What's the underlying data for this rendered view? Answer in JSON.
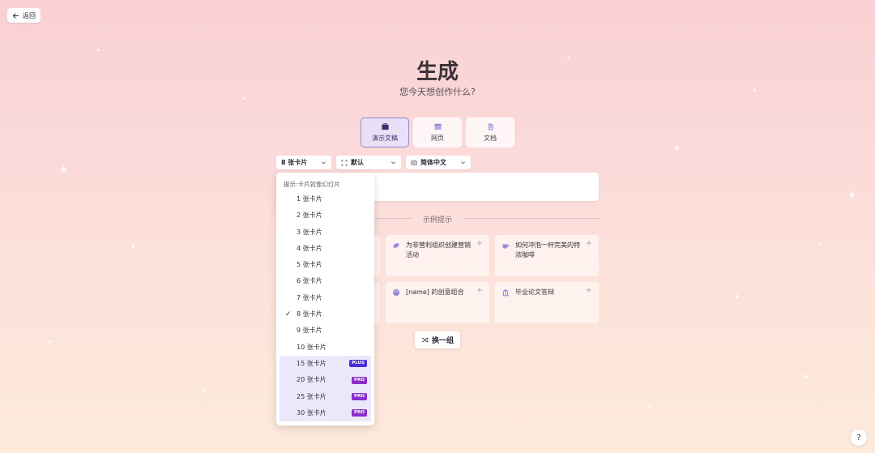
{
  "header": {
    "back_label": "返回"
  },
  "hero": {
    "title": "生成",
    "subtitle": "您今天想创作什么?"
  },
  "types": [
    {
      "label": "演示文稿",
      "icon": "presentation-icon",
      "active": true
    },
    {
      "label": "网页",
      "icon": "webpage-icon",
      "active": false
    },
    {
      "label": "文档",
      "icon": "document-icon",
      "active": false
    }
  ],
  "selects": {
    "cards": "8 张卡片",
    "layout": "默认",
    "language": "简体中文"
  },
  "examples": {
    "label": "示例提示",
    "cards": [
      {
        "text": "为非营利组织创建营销活动",
        "icon": "megaphone-icon"
      },
      {
        "text": "如何冲泡一杯完美的特浓咖啡",
        "icon": "coffee-icon"
      },
      {
        "text": "[name] 的创意组合",
        "icon": "palette-icon"
      },
      {
        "text": "毕业论文答辩",
        "icon": "building-icon"
      }
    ],
    "shuffle_label": "换一组"
  },
  "dropdown": {
    "hint": "提示:卡片就像幻灯片",
    "items": [
      {
        "label": "1 张卡片"
      },
      {
        "label": "2 张卡片"
      },
      {
        "label": "3 张卡片"
      },
      {
        "label": "4 张卡片"
      },
      {
        "label": "5 张卡片"
      },
      {
        "label": "6 张卡片"
      },
      {
        "label": "7 张卡片"
      },
      {
        "label": "8 张卡片",
        "selected": true
      },
      {
        "label": "9 张卡片"
      },
      {
        "label": "10 张卡片"
      },
      {
        "label": "15 张卡片",
        "badge": "PLUS"
      },
      {
        "label": "20 张卡片",
        "badge": "PRO"
      },
      {
        "label": "25 张卡片",
        "badge": "PRO"
      },
      {
        "label": "30 张卡片",
        "badge": "PRO"
      }
    ]
  },
  "help": {
    "label": "?"
  },
  "colors": {
    "accent": "#9a86d6",
    "plus_badge": "#4b2fd6",
    "pro_badge": "#8b2fc9"
  }
}
